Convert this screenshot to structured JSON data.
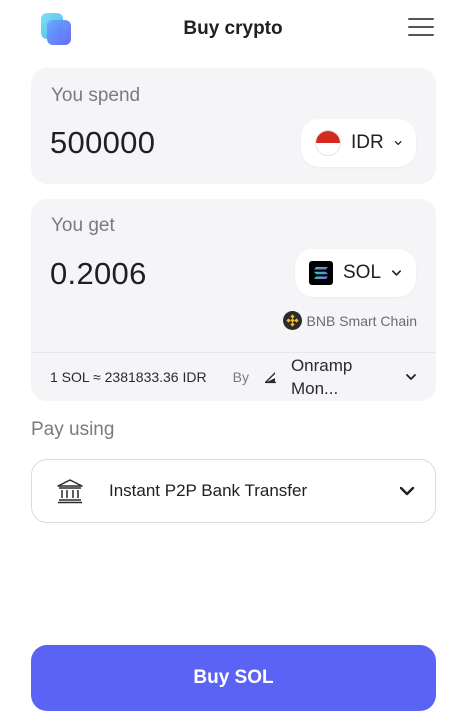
{
  "header": {
    "title": "Buy crypto",
    "logo_icon": "app-logo",
    "menu_icon": "hamburger-menu-icon"
  },
  "spend": {
    "label": "You spend",
    "amount": "500000",
    "currency": "IDR",
    "currency_icon": "indonesia-flag-icon"
  },
  "get": {
    "label": "You get",
    "amount": "0.2006",
    "currency": "SOL",
    "currency_icon": "solana-icon",
    "network": "BNB Smart Chain",
    "network_icon": "bnb-icon"
  },
  "quote": {
    "rate": "1 SOL ≈ 2381833.36 IDR",
    "by_label": "By",
    "provider_line1": "Onramp",
    "provider_line2": "Mon...",
    "provider_icon": "onramp-icon"
  },
  "payment": {
    "label": "Pay using",
    "method": "Instant P2P Bank Transfer",
    "method_icon": "bank-icon"
  },
  "cta": {
    "label": "Buy SOL"
  },
  "colors": {
    "accent": "#5b63f5",
    "card_bg": "#f5f5f7",
    "muted_text": "#7a7a82",
    "text": "#1f1f24"
  }
}
